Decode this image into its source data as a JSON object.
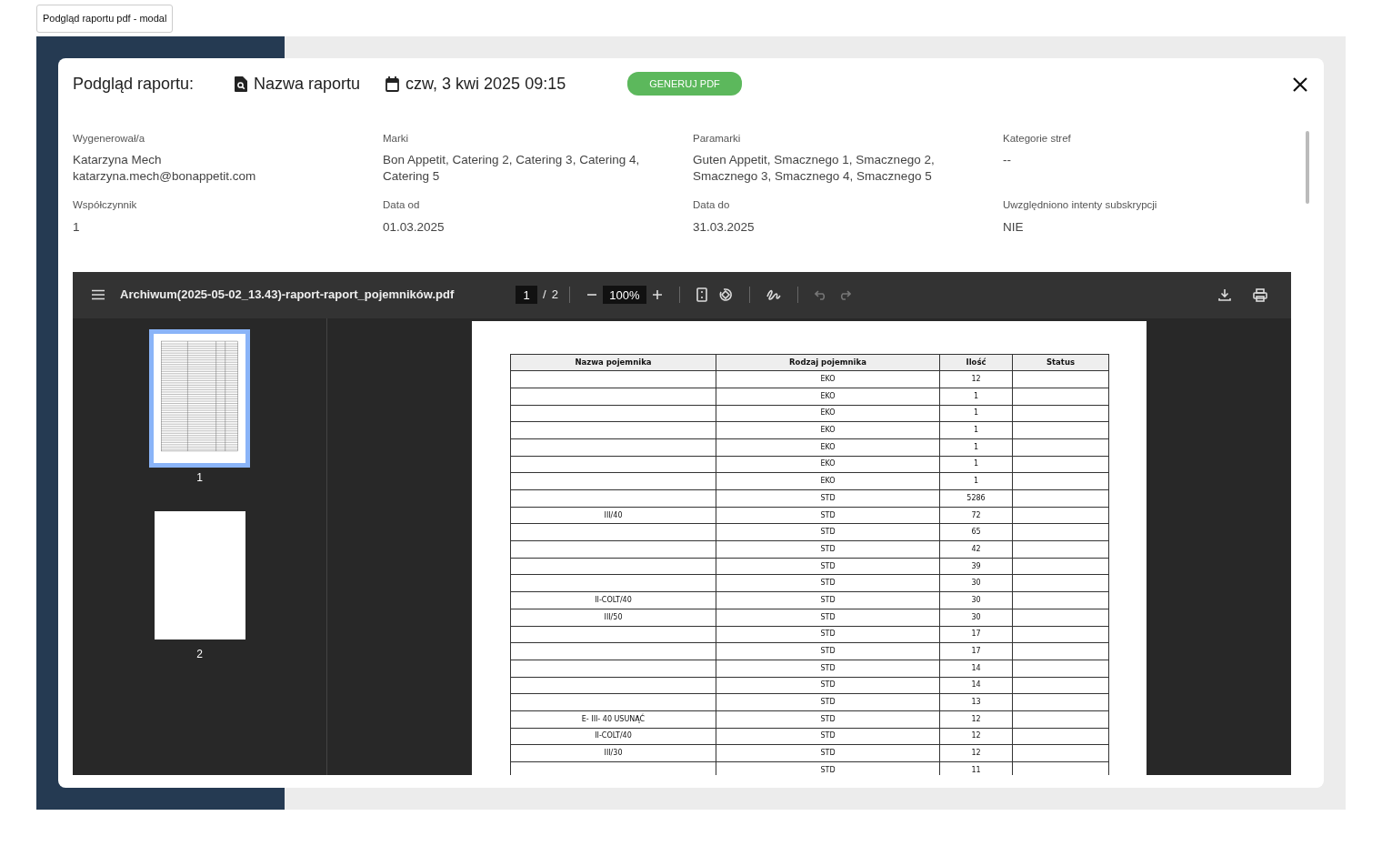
{
  "demo_button": {
    "label": "Podgląd raportu pdf - modal"
  },
  "modal": {
    "title": "Podgląd raportu:",
    "report_name": "Nazwa raportu",
    "date": "czw, 3 kwi 2025 09:15",
    "generate_button": "GENERUJ  PDF",
    "fields": [
      {
        "label": "Wygenerował/a",
        "lines": [
          "Katarzyna Mech",
          "katarzyna.mech@bonappetit.com"
        ]
      },
      {
        "label": "Marki",
        "lines": [
          "Bon Appetit, Catering 2, Catering 3, Catering 4,",
          "Catering 5"
        ]
      },
      {
        "label": "Paramarki",
        "lines": [
          "Guten Appetit, Smacznego 1,  Smacznego 2,",
          "Smacznego 3,  Smacznego 4, Smacznego 5"
        ]
      },
      {
        "label": "Kategorie stref",
        "lines": [
          "--"
        ]
      },
      {
        "label": "Współczynnik",
        "lines": [
          "1"
        ]
      },
      {
        "label": "Data od",
        "lines": [
          "01.03.2025"
        ]
      },
      {
        "label": "Data do",
        "lines": [
          "31.03.2025"
        ]
      },
      {
        "label": "Uwzględniono intenty subskrypcji",
        "lines": [
          "NIE"
        ]
      }
    ]
  },
  "pdf_viewer": {
    "filename": "Archiwum(2025-05-02_13.43)-raport-raport_pojemników.pdf",
    "page_input": "1",
    "page_separator": "/",
    "page_total": "2",
    "zoom": "100%",
    "undo": {
      "disabled": true
    },
    "redo": {
      "disabled": true
    },
    "thumbnails": [
      {
        "label": "1",
        "selected": true,
        "kind": "table"
      },
      {
        "label": "2",
        "selected": false,
        "kind": "blank"
      }
    ],
    "table": {
      "columns": [
        "Nazwa pojemnika",
        "Rodzaj pojemnika",
        "Ilość",
        "Status"
      ],
      "rows": [
        [
          "",
          "EKO",
          "12",
          ""
        ],
        [
          "",
          "EKO",
          "1",
          ""
        ],
        [
          "",
          "EKO",
          "1",
          ""
        ],
        [
          "",
          "EKO",
          "1",
          ""
        ],
        [
          "",
          "EKO",
          "1",
          ""
        ],
        [
          "",
          "EKO",
          "1",
          ""
        ],
        [
          "",
          "EKO",
          "1",
          ""
        ],
        [
          "",
          "STD",
          "5286",
          ""
        ],
        [
          "III/40",
          "STD",
          "72",
          ""
        ],
        [
          "",
          "STD",
          "65",
          ""
        ],
        [
          "",
          "STD",
          "42",
          ""
        ],
        [
          "",
          "STD",
          "39",
          ""
        ],
        [
          "",
          "STD",
          "30",
          ""
        ],
        [
          "II-COLT/40",
          "STD",
          "30",
          ""
        ],
        [
          "III/50",
          "STD",
          "30",
          ""
        ],
        [
          "",
          "STD",
          "17",
          ""
        ],
        [
          "",
          "STD",
          "17",
          ""
        ],
        [
          "",
          "STD",
          "14",
          ""
        ],
        [
          "",
          "STD",
          "14",
          ""
        ],
        [
          "",
          "STD",
          "13",
          ""
        ],
        [
          "E- III- 40 USUNĄĆ",
          "STD",
          "12",
          ""
        ],
        [
          "II-COLT/40",
          "STD",
          "12",
          ""
        ],
        [
          "III/30",
          "STD",
          "12",
          ""
        ],
        [
          "",
          "STD",
          "11",
          ""
        ]
      ]
    }
  }
}
